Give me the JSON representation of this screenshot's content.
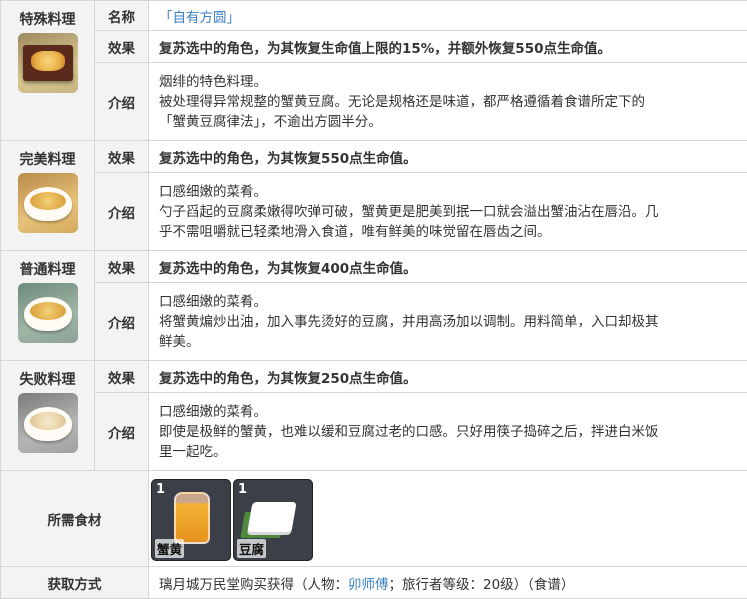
{
  "colors": {
    "border": "#d6d6d6",
    "header_bg": "#f3f3f3",
    "link": "#3a7fc1",
    "ingredient_bg": "#2a2f36"
  },
  "name_row": {
    "label": "名称",
    "value": "「自有方圆」"
  },
  "dishes": [
    {
      "tier": "特殊料理",
      "icon": "special-dish-icon",
      "effect_label": "效果",
      "effect": "复苏选中的角色，为其恢复生命值上限的15%，并额外恢复550点生命值。",
      "intro_label": "介绍",
      "intro_lines": [
        "烟绯的特色料理。",
        "被处理得异常规整的蟹黄豆腐。无论是规格还是味道，都严格遵循着食谱所定下的",
        "「蟹黄豆腐律法」，不逾出方圆半分。"
      ]
    },
    {
      "tier": "完美料理",
      "icon": "perfect-dish-icon",
      "effect_label": "效果",
      "effect": "复苏选中的角色，为其恢复550点生命值。",
      "intro_label": "介绍",
      "intro_lines": [
        "口感细嫩的菜肴。",
        "勺子舀起的豆腐柔嫩得吹弹可破，蟹黄更是肥美到抿一口就会溢出蟹油沾在唇沿。几",
        "乎不需咀嚼就已轻柔地滑入食道，唯有鲜美的味觉留在唇齿之间。"
      ]
    },
    {
      "tier": "普通料理",
      "icon": "normal-dish-icon",
      "effect_label": "效果",
      "effect": "复苏选中的角色，为其恢复400点生命值。",
      "intro_label": "介绍",
      "intro_lines": [
        "口感细嫩的菜肴。",
        "将蟹黄煸炒出油，加入事先烫好的豆腐，并用高汤加以调制。用料简单，入口却极其",
        "鲜美。"
      ]
    },
    {
      "tier": "失败料理",
      "icon": "failed-dish-icon",
      "effect_label": "效果",
      "effect": "复苏选中的角色，为其恢复250点生命值。",
      "intro_label": "介绍",
      "intro_lines": [
        "口感细嫩的菜肴。",
        "即使是极鲜的蟹黄，也难以缓和豆腐过老的口感。只好用筷子捣碎之后，拌进白米饭",
        "里一起吃。"
      ]
    }
  ],
  "ingredients": {
    "label": "所需食材",
    "items": [
      {
        "count": "1",
        "name": "蟹黄",
        "icon": "crab-roe-icon"
      },
      {
        "count": "1",
        "name": "豆腐",
        "icon": "tofu-icon"
      }
    ]
  },
  "obtain": {
    "label": "获取方式",
    "prefix": "璃月城万民堂购买获得（人物：",
    "npc": "卯师傅",
    "suffix": "；旅行者等级：20级）（食谱）"
  }
}
